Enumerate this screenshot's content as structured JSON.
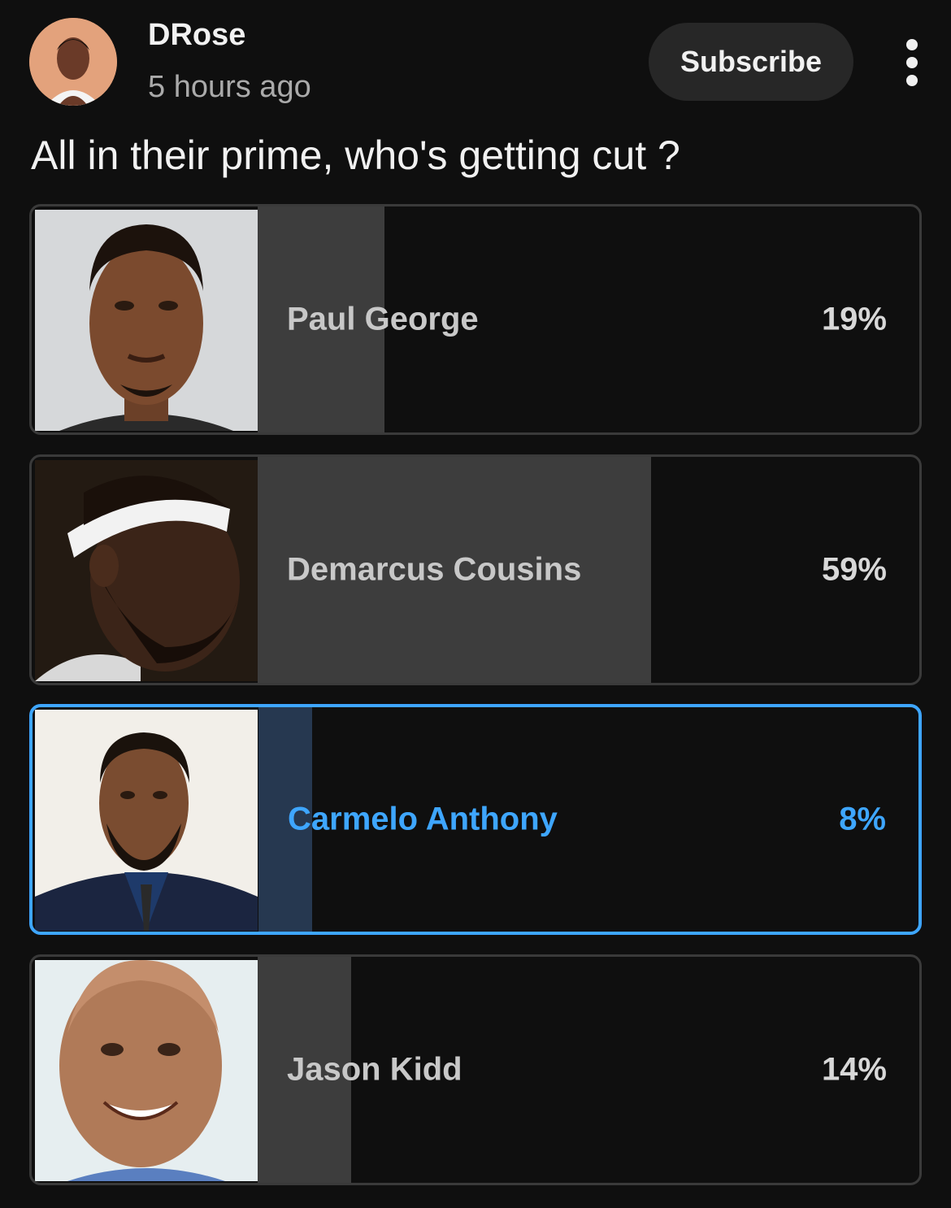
{
  "post": {
    "channel_name": "DRose",
    "time": "5 hours ago",
    "subscribe_label": "Subscribe",
    "question": "All in their prime, who's getting cut ?"
  },
  "poll": {
    "options": [
      {
        "label": "Paul George",
        "percent_text": "19%",
        "percent": 19,
        "selected": false
      },
      {
        "label": "Demarcus Cousins",
        "percent_text": "59%",
        "percent": 59,
        "selected": false
      },
      {
        "label": "Carmelo Anthony",
        "percent_text": "8%",
        "percent": 8,
        "selected": true
      },
      {
        "label": "Jason Kidd",
        "percent_text": "14%",
        "percent": 14,
        "selected": false
      }
    ]
  },
  "colors": {
    "background": "#0f0f0f",
    "selected_accent": "#3ea6ff",
    "bar_fill": "#3d3d3d",
    "selected_bar_fill": "#263850"
  },
  "icons": {
    "more": "more-vertical-icon"
  }
}
